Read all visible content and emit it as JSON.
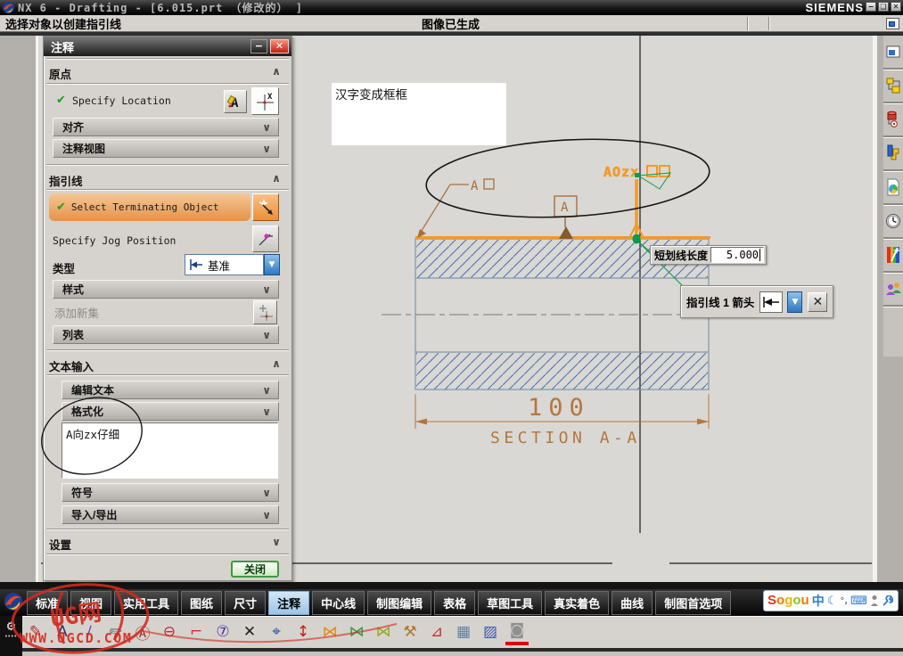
{
  "window": {
    "app_title": "NX 6 - Drafting - [6.015.prt （修改的） ]",
    "brand": "SIEMENS"
  },
  "cue_bar": {
    "message": "选择对象以创建指引线",
    "status": "图像已生成"
  },
  "dialog": {
    "title": "注释",
    "origin_header": "原点",
    "specify_location": "Specify Location",
    "align": "对齐",
    "annotation_view": "注释视图",
    "leader_header": "指引线",
    "select_terminating_object": "Select Terminating Object",
    "specify_jog_position": "Specify Jog Position",
    "type_label": "类型",
    "type_value": "基准",
    "style": "样式",
    "add_new_set": "添加新集",
    "list": "列表",
    "text_input_header": "文本输入",
    "edit_text": "编辑文本",
    "format": "格式化",
    "text_content": "A向zx仔细",
    "symbols": "符号",
    "import_export": "导入/导出",
    "settings_header": "设置",
    "close_button": "关闭"
  },
  "drawing": {
    "note_text": "汉字变成框框",
    "leader_label": "A",
    "datum_label": "A",
    "highlight_text": "AOzx",
    "dimension": "100",
    "section_title": "SECTION A-A",
    "dash_length_label": "短划线长度",
    "dash_length_value": "5.000",
    "leader_arrow_label": "指引线 1 箭头"
  },
  "toolbar_tabs": [
    {
      "id": "standard",
      "label": "标准",
      "active": false
    },
    {
      "id": "view",
      "label": "视图",
      "active": false
    },
    {
      "id": "utility-tools",
      "label": "实用工具",
      "active": false
    },
    {
      "id": "sheet",
      "label": "图纸",
      "active": false
    },
    {
      "id": "dimension",
      "label": "尺寸",
      "active": false
    },
    {
      "id": "annotation",
      "label": "注释",
      "active": true
    },
    {
      "id": "centerline",
      "label": "中心线",
      "active": false
    },
    {
      "id": "drafting-edit",
      "label": "制图编辑",
      "active": false
    },
    {
      "id": "table",
      "label": "表格",
      "active": false
    },
    {
      "id": "sketch-tools",
      "label": "草图工具",
      "active": false
    },
    {
      "id": "true-shading",
      "label": "真实着色",
      "active": false
    },
    {
      "id": "curve",
      "label": "曲线",
      "active": false
    },
    {
      "id": "drafting-preferences",
      "label": "制图首选项",
      "active": false
    }
  ],
  "bottom_icons": [
    {
      "name": "note-edit-icon",
      "glyph": "✎",
      "color": "#b03030"
    },
    {
      "name": "text-edit-icon",
      "glyph": "A",
      "color": "#303060"
    },
    {
      "name": "leader-line-edit-icon",
      "glyph": "∕",
      "color": "#8833cc"
    },
    {
      "name": "symbol-edit-icon",
      "glyph": "✏",
      "color": "#607080"
    },
    {
      "name": "datum-feature-icon",
      "glyph": "Ⓐ",
      "color": "#a03030"
    },
    {
      "name": "datum-target-icon",
      "glyph": "⊖",
      "color": "#b03030"
    },
    {
      "name": "feature-control-frame-icon",
      "glyph": "⌐",
      "color": "#cc3030"
    },
    {
      "name": "balloon-7-icon",
      "glyph": "⑦",
      "color": "#5030a0"
    },
    {
      "name": "cross-symbol-icon",
      "glyph": "✕",
      "color": "#202020"
    },
    {
      "name": "target-point-icon",
      "glyph": "⌖",
      "color": "#3050a0"
    },
    {
      "name": "ordinate-dimension-icon",
      "glyph": "↕",
      "color": "#c02020"
    },
    {
      "name": "weld-symbol-orange-icon",
      "glyph": "⋈",
      "color": "#e08a10"
    },
    {
      "name": "weld-symbol-green-icon",
      "glyph": "⋈",
      "color": "#28a040"
    },
    {
      "name": "weld-star-icon",
      "glyph": "⋈",
      "color": "#8faa20"
    },
    {
      "name": "weld-hammer-icon",
      "glyph": "⚒",
      "color": "#b07830"
    },
    {
      "name": "surface-finish-icon",
      "glyph": "⊿",
      "color": "#c03030"
    },
    {
      "name": "image-icon",
      "glyph": "▦",
      "color": "#6080a0"
    },
    {
      "name": "crosshatch-icon",
      "glyph": "▨",
      "color": "#3858a8"
    },
    {
      "name": "area-fill-icon",
      "glyph": "◙",
      "color": "#909090"
    }
  ],
  "resource_icons": [
    "display-window-icon",
    "assembly-navigator-icon",
    "constraint-navigator-icon",
    "part-navigator-icon",
    "dependencies-icon",
    "history-icon",
    "materials-icon",
    "roles-icon"
  ],
  "ime": {
    "letters": [
      {
        "ch": "S",
        "color": "#e0351b"
      },
      {
        "ch": "o",
        "color": "#f07800"
      },
      {
        "ch": "g",
        "color": "#f0b400"
      },
      {
        "ch": "o",
        "color": "#8cc320"
      },
      {
        "ch": "u",
        "color": "#f07800"
      }
    ],
    "lang": "中"
  },
  "watermark": {
    "line1": "UG网",
    "line2": "WWW.UGCD.COM"
  },
  "colors": {
    "accent_orange": "#f59a23",
    "hatch_blue": "#4a6fa8",
    "dim_brown": "#b5763c",
    "select_green": "#0b9b4b",
    "highlight_row": "#f0a050",
    "active_tab": "#b9d9f2"
  }
}
